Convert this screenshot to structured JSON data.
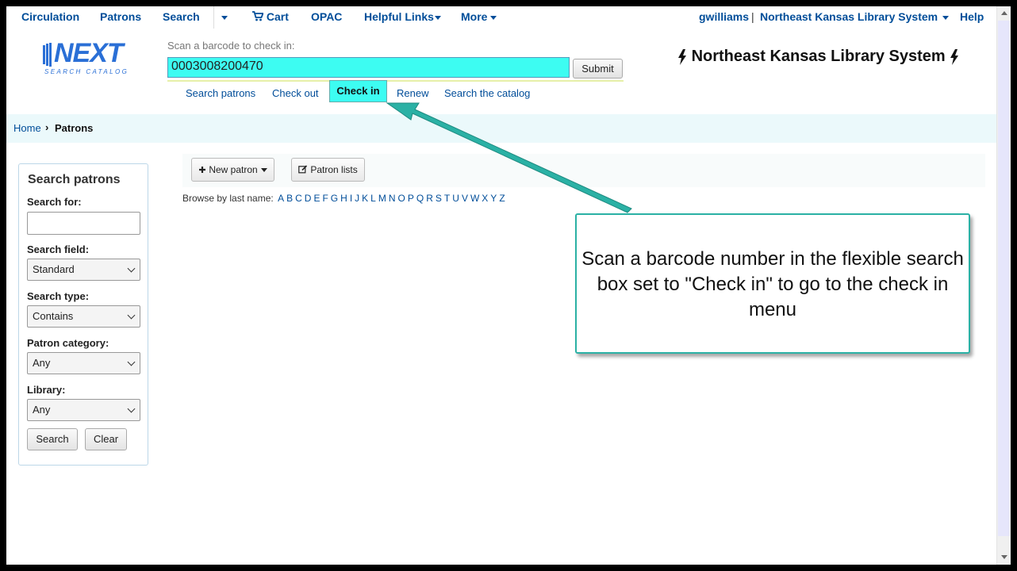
{
  "topnav": {
    "circulation": "Circulation",
    "patrons": "Patrons",
    "search": "Search",
    "cart": "Cart",
    "opac": "OPAC",
    "helpful_links": "Helpful Links",
    "more": "More",
    "user": "gwilliams",
    "divider": "|",
    "library": "Northeast Kansas Library System",
    "help": "Help"
  },
  "logo": {
    "name": "NEXT",
    "tagline": "SEARCH CATALOG"
  },
  "scan": {
    "label": "Scan a barcode to check in:",
    "value": "0003008200470",
    "submit": "Submit"
  },
  "subnav": {
    "search_patrons": "Search patrons",
    "check_out": "Check out",
    "check_in": "Check in",
    "renew": "Renew",
    "search_catalog": "Search the catalog"
  },
  "brand": "Northeast Kansas Library System",
  "breadcrumb": {
    "home": "Home",
    "separator": "›",
    "current": "Patrons"
  },
  "sidebar": {
    "title": "Search patrons",
    "search_for_label": "Search for:",
    "search_for_value": "",
    "search_field_label": "Search field:",
    "search_field_value": "Standard",
    "search_type_label": "Search type:",
    "search_type_value": "Contains",
    "patron_category_label": "Patron category:",
    "patron_category_value": "Any",
    "library_label": "Library:",
    "library_value": "Any",
    "search_button": "Search",
    "clear_button": "Clear"
  },
  "toolbar": {
    "new_patron": "New patron",
    "patron_lists": "Patron lists"
  },
  "browse": {
    "label": "Browse by last name:",
    "letters": [
      "A",
      "B",
      "C",
      "D",
      "E",
      "F",
      "G",
      "H",
      "I",
      "J",
      "K",
      "L",
      "M",
      "N",
      "O",
      "P",
      "Q",
      "R",
      "S",
      "T",
      "U",
      "V",
      "W",
      "X",
      "Y",
      "Z"
    ]
  },
  "callout": "Scan a barcode number in the flexible search box set to \"Check in\" to go to the check in menu",
  "colors": {
    "highlight": "#3dfcf2",
    "callout_border": "#2bb1a5",
    "link": "#004d99"
  }
}
